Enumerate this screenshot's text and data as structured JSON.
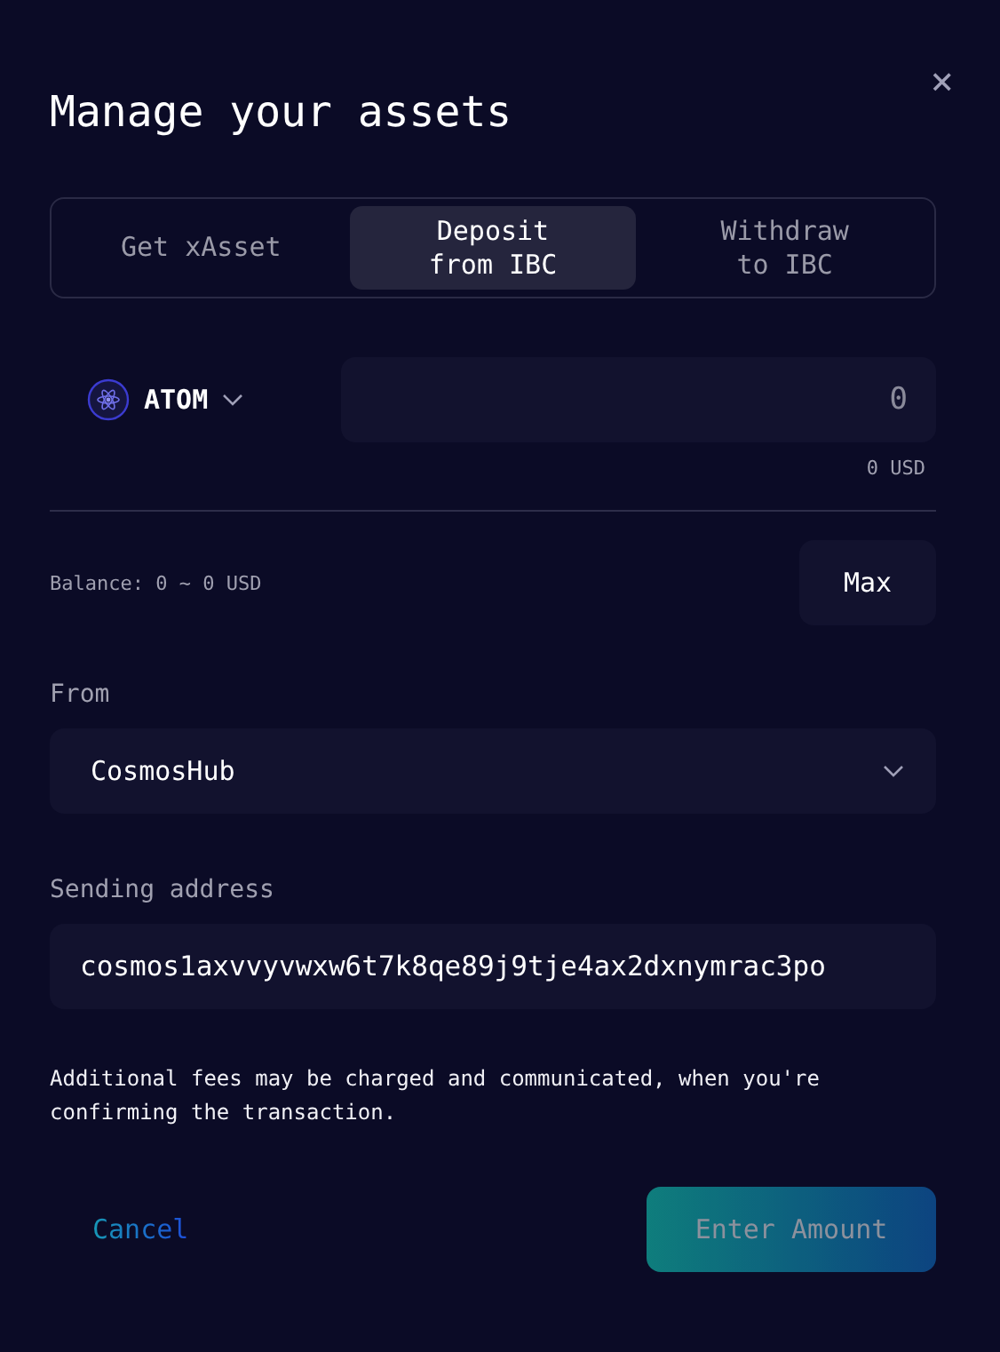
{
  "dialog": {
    "title": "Manage your assets",
    "close": "×"
  },
  "tabs": [
    {
      "label": "Get xAsset",
      "selected": false
    },
    {
      "label": "Deposit\nfrom IBC",
      "selected": true
    },
    {
      "label": "Withdraw\nto IBC",
      "selected": false
    }
  ],
  "asset": {
    "symbol": "ATOM"
  },
  "amount": {
    "placeholder": "0",
    "usd": "0 USD"
  },
  "balance": "Balance: 0 ~ 0 USD",
  "max_button": "Max",
  "from": {
    "label": "From",
    "value": "CosmosHub"
  },
  "sending_address": {
    "label": "Sending address",
    "value": "cosmos1axvvyvwxw6t7k8qe89j9tje4ax2dxnymrac3po"
  },
  "note": "Additional fees may be charged and communicated, when you're confirming the transaction.",
  "cancel": "Cancel",
  "submit": {
    "label": "Enter Amount",
    "disabled": true
  }
}
